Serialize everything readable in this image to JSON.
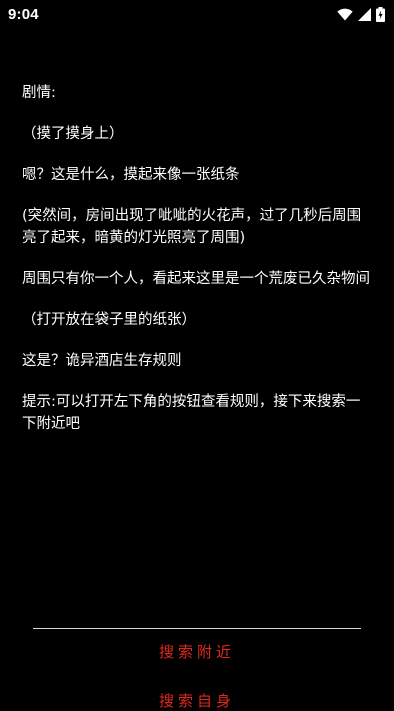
{
  "status_bar": {
    "time": "9:04",
    "icons": [
      "wifi-icon",
      "signal-icon",
      "battery-icon"
    ]
  },
  "story": {
    "paragraphs": [
      "剧情:",
      "（摸了摸身上）",
      "嗯？这是什么，摸起来像一张纸条",
      "(突然间，房间出现了呲呲的火花声，过了几秒后周围亮了起来，暗黄的灯光照亮了周围)",
      "周围只有你一个人，看起来这里是一个荒废已久杂物间",
      "（打开放在袋子里的纸张）",
      "这是？诡异酒店生存规则",
      "提示:可以打开左下角的按钮查看规则，接下来搜索一下附近吧"
    ]
  },
  "actions": {
    "search_label": "搜索附近",
    "self_label": "搜索自身"
  },
  "colors": {
    "background": "#000000",
    "text": "#ffffff",
    "action": "#e0271f",
    "divider": "#d9d9d9"
  }
}
